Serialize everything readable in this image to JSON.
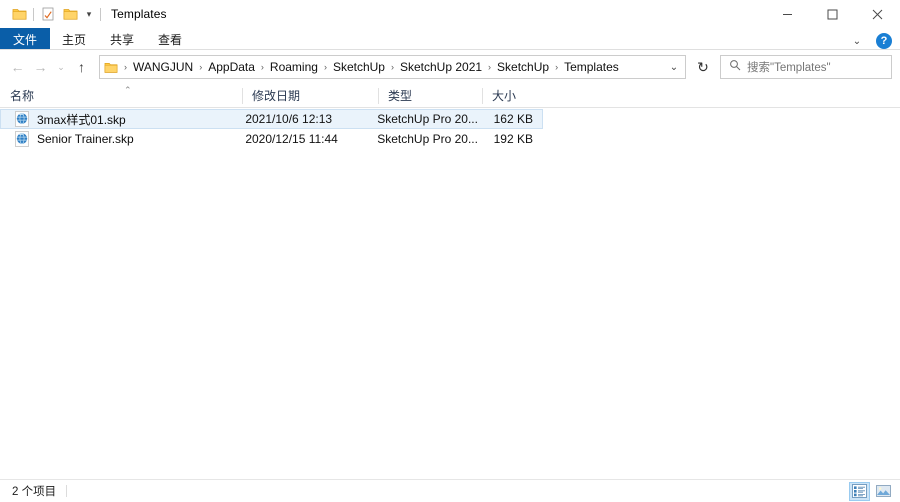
{
  "window": {
    "title": "Templates",
    "quick_access": [
      {
        "name": "folder-icon",
        "label": ""
      },
      {
        "name": "properties-icon",
        "label": ""
      },
      {
        "name": "new-folder-icon",
        "label": ""
      },
      {
        "name": "chevron-down-icon",
        "label": "▾"
      }
    ],
    "controls": {
      "minimize": "—",
      "maximize": "▢",
      "close": "✕"
    }
  },
  "ribbon": {
    "tabs": [
      {
        "label": "文件",
        "active": true
      },
      {
        "label": "主页",
        "active": false
      },
      {
        "label": "共享",
        "active": false
      },
      {
        "label": "查看",
        "active": false
      }
    ],
    "collapse_caret": "⌄",
    "help_label": "?"
  },
  "address": {
    "back": "←",
    "forward": "→",
    "recent": "⌄",
    "up": "↑",
    "crumbs": [
      "WANGJUN",
      "AppData",
      "Roaming",
      "SketchUp",
      "SketchUp 2021",
      "SketchUp",
      "Templates"
    ],
    "separator": "›",
    "dropdown_caret": "⌄",
    "refresh": "↻"
  },
  "search": {
    "placeholder": "搜索\"Templates\"",
    "value": ""
  },
  "columns": [
    {
      "key": "name",
      "label": "名称",
      "sorted": true,
      "sort_dir": "asc",
      "sort_glyph": "⌃"
    },
    {
      "key": "date",
      "label": "修改日期",
      "sorted": false
    },
    {
      "key": "type",
      "label": "类型",
      "sorted": false
    },
    {
      "key": "size",
      "label": "大小",
      "sorted": false
    }
  ],
  "files": [
    {
      "icon": "sketchup-file-icon",
      "name": "3max样式01.skp",
      "date": "2021/10/6 12:13",
      "type": "SketchUp Pro 20...",
      "size": "162 KB",
      "selected": true
    },
    {
      "icon": "sketchup-file-icon",
      "name": "Senior Trainer.skp",
      "date": "2020/12/15 11:44",
      "type": "SketchUp Pro 20...",
      "size": "192 KB",
      "selected": false
    }
  ],
  "status": {
    "item_count_text": "2 个项目"
  },
  "view_buttons": [
    {
      "name": "details-view-button",
      "active": true
    },
    {
      "name": "large-icons-view-button",
      "active": false
    }
  ],
  "colors": {
    "accent": "#0a5ea8",
    "selection_bg": "#eaf3fb",
    "selection_border": "#cce0f2",
    "help_blue": "#1a7fd4",
    "folder_yellow": "#ffca42",
    "header_text": "#2b3a52"
  }
}
